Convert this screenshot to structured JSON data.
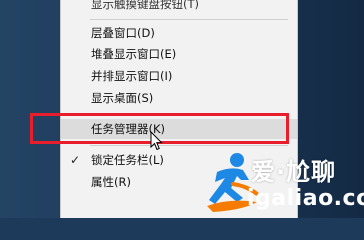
{
  "context_menu": {
    "items": [
      {
        "label": "显示触摸键盘按钮(T)",
        "checked": false,
        "hover": false
      },
      {
        "label": "层叠窗口(D)",
        "checked": false,
        "hover": false
      },
      {
        "label": "堆叠显示窗口(E)",
        "checked": false,
        "hover": false
      },
      {
        "label": "并排显示窗口(I)",
        "checked": false,
        "hover": false
      },
      {
        "label": "显示桌面(S)",
        "checked": false,
        "hover": false
      },
      {
        "label": "任务管理器(K)",
        "checked": false,
        "hover": true
      },
      {
        "label": "锁定任务栏(L)",
        "checked": true,
        "hover": false
      },
      {
        "label": "属性(R)",
        "checked": false,
        "hover": false
      }
    ],
    "check_icon": "✓"
  },
  "annotation": {
    "highlight_color": "#e81e2c"
  },
  "watermark": {
    "title": "爱·尬聊",
    "url": "igaliao.com",
    "logo_icon": "running-figure-logo"
  },
  "colors": {
    "desktop_background": "#1e3a5b",
    "menu_background": "#f2f2f2",
    "hover_background": "#dcdcdc"
  }
}
